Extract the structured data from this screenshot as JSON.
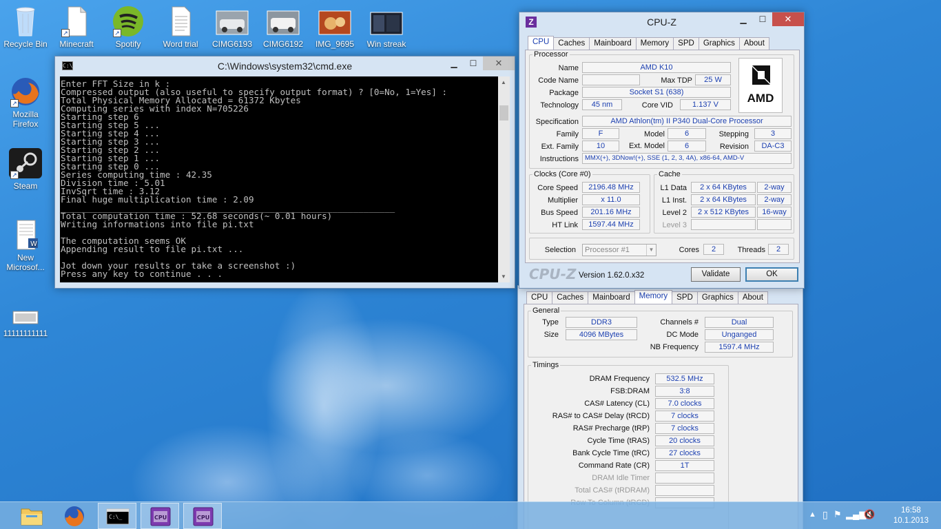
{
  "desktop": {
    "icons": [
      {
        "label": "Recycle Bin"
      },
      {
        "label": "Minecraft"
      },
      {
        "label": "Spotify"
      },
      {
        "label": "Word trial"
      },
      {
        "label": "CIMG6193"
      },
      {
        "label": "CIMG6192"
      },
      {
        "label": "IMG_9695"
      },
      {
        "label": "Win streak"
      },
      {
        "label": "Mozilla Firefox"
      },
      {
        "label": "Steam"
      },
      {
        "label": "New Microsof..."
      },
      {
        "label": "11111111111"
      }
    ]
  },
  "cmd": {
    "title": "C:\\Windows\\system32\\cmd.exe",
    "lines": [
      "Enter FFT Size in k :",
      "Compressed output (also useful to specify output format) ? [0=No, 1=Yes] :",
      "Total Physical Memory Allocated = 61372 Kbytes",
      "Computing series with index N=705226",
      "Starting step 6",
      "Starting step 5 ...",
      "Starting step 4 ...",
      "Starting step 3 ...",
      "Starting step 2 ...",
      "Starting step 1 ...",
      "Starting step 0 ...",
      "Series computing time : 42.35",
      "Division time : 5.01",
      "InvSqrt time : 3.12",
      "Final huge multiplication time : 2.09",
      "________________________________________________________________",
      "Total computation time : 52.68 seconds(~ 0.01 hours)",
      "Writing informations into file pi.txt",
      "",
      "The computation seems OK",
      "Appending result to file pi.txt ...",
      "",
      "Jot down your results or take a screenshot :)",
      "Press any key to continue . . ."
    ]
  },
  "cpuz1": {
    "title": "CPU-Z",
    "tabs": [
      "CPU",
      "Caches",
      "Mainboard",
      "Memory",
      "SPD",
      "Graphics",
      "About"
    ],
    "processor": {
      "legend": "Processor",
      "name_label": "Name",
      "name": "AMD K10",
      "code_name_label": "Code Name",
      "max_tdp_label": "Max TDP",
      "max_tdp": "25 W",
      "package_label": "Package",
      "package": "Socket S1 (638)",
      "technology_label": "Technology",
      "technology": "45 nm",
      "core_vid_label": "Core VID",
      "core_vid": "1.137 V",
      "specification_label": "Specification",
      "specification": "AMD Athlon(tm) II P340 Dual-Core Processor",
      "family_label": "Family",
      "family": "F",
      "model_label": "Model",
      "model": "6",
      "stepping_label": "Stepping",
      "stepping": "3",
      "ext_family_label": "Ext. Family",
      "ext_family": "10",
      "ext_model_label": "Ext. Model",
      "ext_model": "6",
      "revision_label": "Revision",
      "revision": "DA-C3",
      "instructions_label": "Instructions",
      "instructions": "MMX(+), 3DNow!(+), SSE (1, 2, 3, 4A), x86-64, AMD-V",
      "logo": "AMD"
    },
    "clocks": {
      "legend": "Clocks (Core #0)",
      "core_speed_label": "Core Speed",
      "core_speed": "2196.48 MHz",
      "multiplier_label": "Multiplier",
      "multiplier": "x 11.0",
      "bus_speed_label": "Bus Speed",
      "bus_speed": "201.16 MHz",
      "ht_link_label": "HT Link",
      "ht_link": "1597.44 MHz"
    },
    "cache": {
      "legend": "Cache",
      "l1d_label": "L1 Data",
      "l1d": "2 x 64 KBytes",
      "l1d_way": "2-way",
      "l1i_label": "L1 Inst.",
      "l1i": "2 x 64 KBytes",
      "l1i_way": "2-way",
      "l2_label": "Level 2",
      "l2": "2 x 512 KBytes",
      "l2_way": "16-way",
      "l3_label": "Level 3"
    },
    "selection_label": "Selection",
    "selection": "Processor #1",
    "cores_label": "Cores",
    "cores": "2",
    "threads_label": "Threads",
    "threads": "2",
    "brand": "CPU-Z",
    "version": "Version 1.62.0.x32",
    "validate": "Validate",
    "ok": "OK"
  },
  "cpuz2": {
    "tabs": [
      "CPU",
      "Caches",
      "Mainboard",
      "Memory",
      "SPD",
      "Graphics",
      "About"
    ],
    "general": {
      "legend": "General",
      "type_label": "Type",
      "type": "DDR3",
      "size_label": "Size",
      "size": "4096 MBytes",
      "channels_label": "Channels #",
      "channels": "Dual",
      "dc_mode_label": "DC Mode",
      "dc_mode": "Unganged",
      "nb_freq_label": "NB Frequency",
      "nb_freq": "1597.4 MHz"
    },
    "timings": {
      "legend": "Timings",
      "rows": [
        {
          "label": "DRAM Frequency",
          "value": "532.5 MHz"
        },
        {
          "label": "FSB:DRAM",
          "value": "3:8"
        },
        {
          "label": "CAS# Latency (CL)",
          "value": "7.0 clocks"
        },
        {
          "label": "RAS# to CAS# Delay (tRCD)",
          "value": "7 clocks"
        },
        {
          "label": "RAS# Precharge (tRP)",
          "value": "7 clocks"
        },
        {
          "label": "Cycle Time (tRAS)",
          "value": "20 clocks"
        },
        {
          "label": "Bank Cycle Time (tRC)",
          "value": "27 clocks"
        },
        {
          "label": "Command Rate (CR)",
          "value": "1T"
        },
        {
          "label": "DRAM Idle Timer",
          "value": ""
        },
        {
          "label": "Total CAS# (tRDRAM)",
          "value": ""
        },
        {
          "label": "Row To Column (tRCD)",
          "value": ""
        }
      ]
    }
  },
  "taskbar": {
    "time": "16:58",
    "date": "10.1.2013"
  }
}
